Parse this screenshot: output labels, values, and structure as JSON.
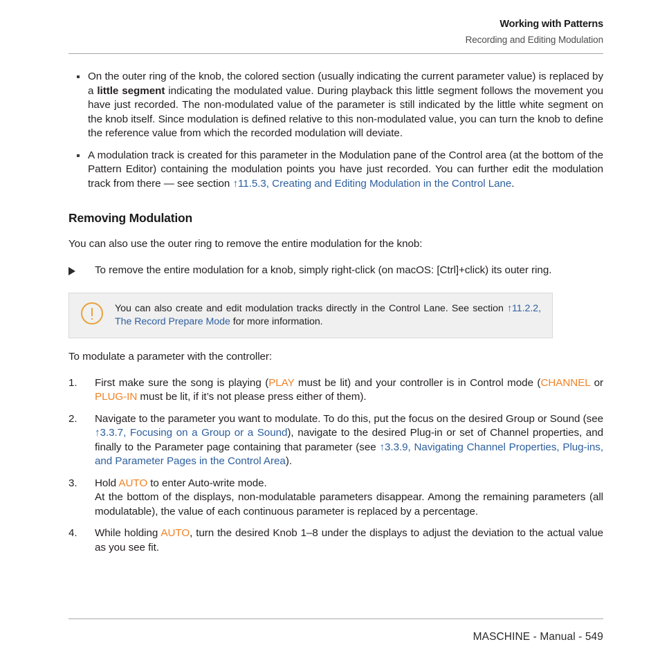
{
  "header": {
    "title": "Working with Patterns",
    "subtitle": "Recording and Editing Modulation"
  },
  "bullets": [
    {
      "id": "bullet-outer-ring",
      "part1": "On the outer ring of the knob, the colored section (usually indicating the current parameter value) is replaced by a ",
      "bold": "little segment",
      "part2": " indicating the modulated value. During playback this little segment follows the movement you have just recorded. The non-modulated value of the parameter is still indicated by the little white segment on the knob itself. Since modulation is defined relative to this non-modulated value, you can turn the knob to define the reference value from which the recorded modulation will deviate."
    },
    {
      "id": "bullet-modulation-track",
      "part1": "A modulation track is created for this parameter in the Modulation pane of the Control area (at the bottom of the Pattern Editor) containing the modulation points you have just recorded. You can further edit the modulation track from there — see section ",
      "link": "↑11.5.3, Creating and Editing Modulation in the Control Lane",
      "part2": "."
    }
  ],
  "section": {
    "heading": "Removing Modulation",
    "intro": "You can also use the outer ring to remove the entire modulation for the knob:",
    "procedure": "To remove the entire modulation for a knob, simply right-click (on macOS: [Ctrl]+click) its outer ring."
  },
  "note": {
    "icon": "exclamation-circle-icon",
    "part1": "You can also create and edit modulation tracks directly in the Control Lane. See section ",
    "link": "↑11.2.2, The Record Prepare Mode",
    "part2": " for more information.",
    "accent_color": "#e8a33d",
    "background_color": "#f0f0f0"
  },
  "steps_intro": "To modulate a parameter with the controller:",
  "steps": [
    {
      "number": "1.",
      "seg": [
        {
          "t": "First make sure the song is playing (",
          "k": "plain"
        },
        {
          "t": "PLAY",
          "k": "hw"
        },
        {
          "t": " must be lit) and your controller is in Control mode (",
          "k": "plain"
        },
        {
          "t": "CHANNEL",
          "k": "hw"
        },
        {
          "t": " or ",
          "k": "plain"
        },
        {
          "t": "PLUG-IN",
          "k": "hw"
        },
        {
          "t": " must be lit, if it’s not please press either of them).",
          "k": "plain"
        }
      ]
    },
    {
      "number": "2.",
      "seg": [
        {
          "t": "Navigate to the parameter you want to modulate. To do this, put the focus on the desired Group or Sound (see ",
          "k": "plain"
        },
        {
          "t": "↑3.3.7, Focusing on a Group or a Sound",
          "k": "link"
        },
        {
          "t": "), navigate to the desired Plug-in or set of Channel properties, and finally to the Parameter page containing that parameter (see ",
          "k": "plain"
        },
        {
          "t": "↑3.3.9, Navigating Channel Properties, Plug-ins, and Parameter Pages in the Control Area",
          "k": "link"
        },
        {
          "t": ").",
          "k": "plain"
        }
      ]
    },
    {
      "number": "3.",
      "seg": [
        {
          "t": "Hold ",
          "k": "plain"
        },
        {
          "t": "AUTO",
          "k": "hw"
        },
        {
          "t": " to enter Auto-write mode.",
          "k": "plain"
        },
        {
          "t": "",
          "k": "br"
        },
        {
          "t": "At the bottom of the displays, non-modulatable parameters disappear. Among the remaining parameters (all modulatable), the value of each continuous parameter is replaced by a percentage.",
          "k": "plain"
        }
      ]
    },
    {
      "number": "4.",
      "seg": [
        {
          "t": "While holding ",
          "k": "plain"
        },
        {
          "t": "AUTO",
          "k": "hw"
        },
        {
          "t": ", turn the desired Knob 1–8 under the displays to adjust the deviation to the actual value as you see fit.",
          "k": "plain"
        }
      ]
    }
  ],
  "footer": {
    "text": "MASCHINE - Manual - 549"
  },
  "colors": {
    "link": "#2e5f9e",
    "hardware": "#ef8326",
    "text": "#231f20",
    "rule": "#a7a7a7"
  }
}
